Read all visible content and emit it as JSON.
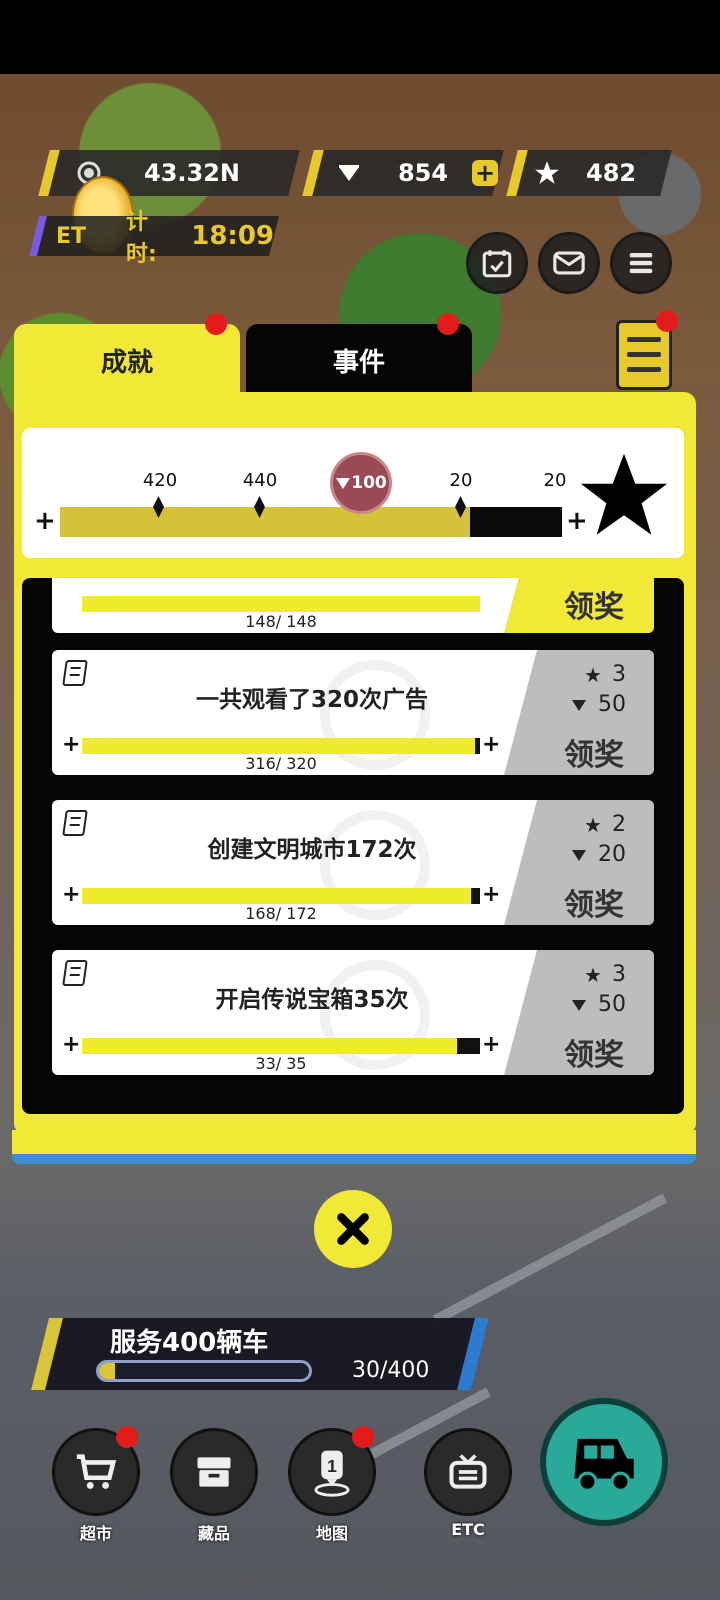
{
  "resources": {
    "coins": "43.32N",
    "gems": "854",
    "stars": "482"
  },
  "timer": {
    "label_prefix": "ET",
    "label_suffix": "计时:",
    "value": "18:09"
  },
  "tabs": [
    {
      "label": "成就",
      "active": true
    },
    {
      "label": "事件",
      "active": false
    }
  ],
  "milestones": {
    "labels": [
      "420",
      "440",
      "100",
      "20",
      "20"
    ],
    "plus_left": "+",
    "plus_right": "+"
  },
  "achievements": [
    {
      "title": "",
      "progress": "148/ 148",
      "current": 148,
      "target": 148,
      "claim": "领奖"
    },
    {
      "title": "一共观看了320次广告",
      "progress": "316/ 320",
      "current": 316,
      "target": 320,
      "stars": "3",
      "gems": "50",
      "claim": "领奖"
    },
    {
      "title": "创建文明城市172次",
      "progress": "168/ 172",
      "current": 168,
      "target": 172,
      "stars": "2",
      "gems": "20",
      "claim": "领奖"
    },
    {
      "title": "开启传说宝箱35次",
      "progress": "33/ 35",
      "current": 33,
      "target": 35,
      "stars": "3",
      "gems": "50",
      "claim": "领奖"
    }
  ],
  "quest": {
    "title": "服务400辆车",
    "progress": "30/400",
    "fraction": 0.075
  },
  "nav": [
    {
      "label": "超市",
      "icon": "cart-icon"
    },
    {
      "label": "藏品",
      "icon": "box-icon"
    },
    {
      "label": "地图",
      "icon": "map-pin-icon",
      "badge": "1"
    },
    {
      "label": "ETC",
      "icon": "tv-icon"
    }
  ],
  "colors": {
    "panel_yellow": "#f2e836",
    "accent_red": "#e31b1b",
    "main_teal": "#2aa89a"
  }
}
